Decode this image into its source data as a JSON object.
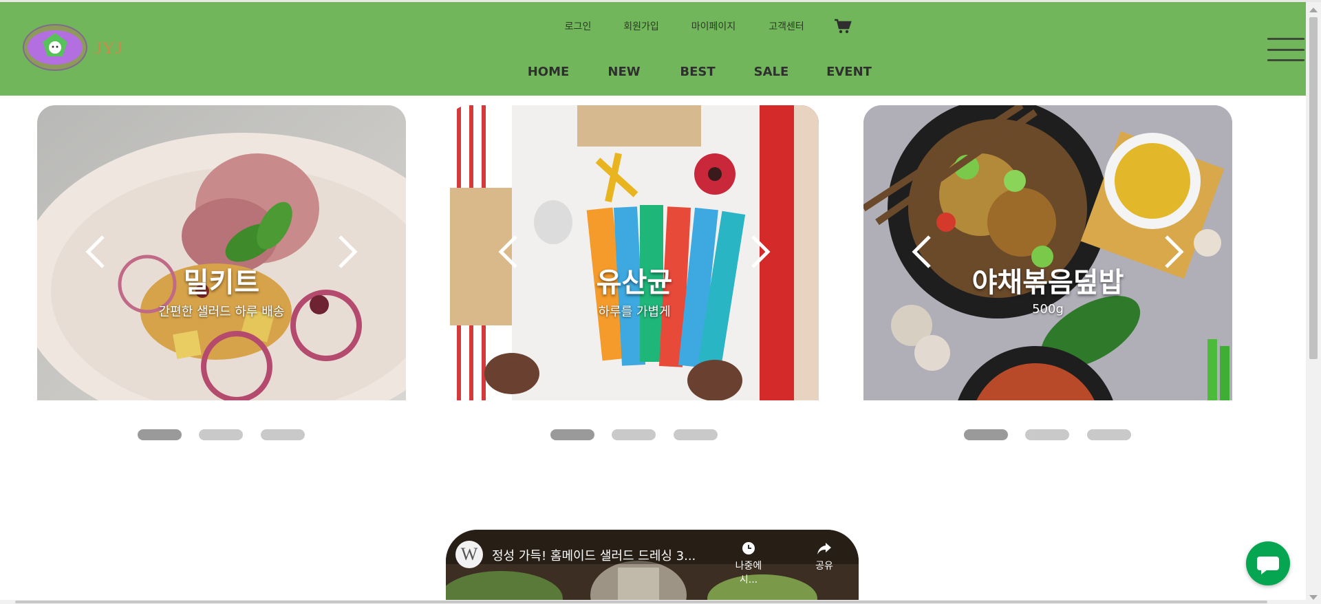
{
  "brand": {
    "logo_text": "JYJ"
  },
  "header": {
    "utility_links": [
      "로그인",
      "회원가입",
      "마이페이지",
      "고객센터"
    ],
    "main_nav": [
      "HOME",
      "NEW",
      "BEST",
      "SALE",
      "EVENT"
    ],
    "cart_icon": "cart-icon",
    "menu_icon": "hamburger-menu-icon",
    "background_color": "#71b65a"
  },
  "sliders": [
    {
      "title": "밀키트",
      "subtitle": "간편한 샐러드 하루 배송",
      "active_slide": 1,
      "slide_count": 3
    },
    {
      "title": "유산균",
      "subtitle": "하루를 가볍게",
      "active_slide": 1,
      "slide_count": 3
    },
    {
      "title": "야채볶음덮밥",
      "subtitle": "500g",
      "active_slide": 1,
      "slide_count": 3
    }
  ],
  "video": {
    "channel_initial": "W",
    "title": "정성 가득! 홈메이드 샐러드 드레싱 3...",
    "watch_later_label": "나중에 시...",
    "share_label": "공유"
  },
  "chat": {
    "icon": "chat-bubble-icon",
    "color": "#06a552"
  }
}
